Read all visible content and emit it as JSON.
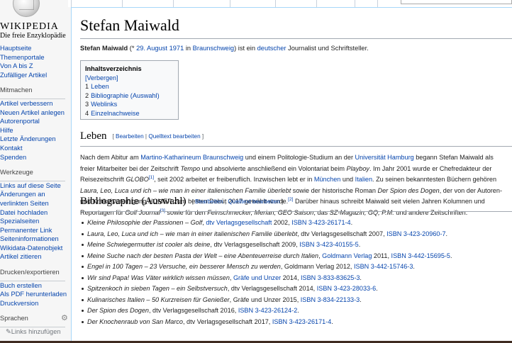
{
  "logo": {
    "wordmark": "WIKIPEDIA",
    "tagline": "Die freie Enzyklopädie"
  },
  "sidebar": {
    "nav": [
      "Hauptseite",
      "Themenportale",
      "Von A bis Z",
      "Zufälliger Artikel"
    ],
    "mitmachen": {
      "heading": "Mitmachen",
      "items": [
        "Artikel verbessern",
        "Neuen Artikel anlegen",
        "Autorenportal",
        "Hilfe",
        "Letzte Änderungen",
        "Kontakt",
        "Spenden"
      ]
    },
    "werkzeuge": {
      "heading": "Werkzeuge",
      "items": [
        "Links auf diese Seite",
        "Änderungen an",
        "verlinkten Seiten",
        "Datei hochladen",
        "Spezialseiten",
        "Permanenter Link",
        "Seiteninformationen",
        "Wikidata-Datenobjekt",
        "Artikel zitieren"
      ]
    },
    "drucken": {
      "heading": "Drucken/exportieren",
      "items": [
        "Buch erstellen",
        "Als PDF herunterladen",
        "Druckversion"
      ]
    },
    "sprachen": {
      "heading": "Sprachen",
      "add_links": "Links hinzufügen"
    }
  },
  "page": {
    "title": "Stefan Maiwald",
    "lead": {
      "name": "Stefan Maiwald",
      "pre": " (* ",
      "date": "29. August 1971",
      "in": " in ",
      "city": "Braunschweig",
      "mid": ") ist ein ",
      "nationality": "deutscher",
      "rest": " Journalist und Schriftsteller."
    },
    "toc": {
      "title": "Inhaltsverzeichnis",
      "toggle": "[Verbergen]",
      "entries": [
        {
          "num": "1",
          "label": "Leben"
        },
        {
          "num": "2",
          "label": "Bibliographie (Auswahl)"
        },
        {
          "num": "3",
          "label": "Weblinks"
        },
        {
          "num": "4",
          "label": "Einzelnachweise"
        }
      ]
    },
    "edit": {
      "open": "[ ",
      "edit": "Bearbeiten",
      "sep": " | ",
      "source": "Quelltext bearbeiten",
      "close": " ]"
    },
    "leben": {
      "heading": "Leben",
      "l1": {
        "a": "Nach dem Abitur am ",
        "link1": "Martino-Katharineum Braunschweig",
        "b": " und einem Politologie-Studium an der ",
        "link2": "Universität Hamburg",
        "c": " begann Stefan Maiwald als"
      },
      "l2": {
        "a": "freier Mitarbeiter bei der Zeitschrift ",
        "i1": "Tempo",
        "b": " und absolvierte anschließend ein Volontariat beim ",
        "i2": "Playboy",
        "c": ". Im Jahr 2001 wurde er Chefredakteur der"
      },
      "l3": {
        "a": "Reisezeitschrift ",
        "i1": "GLOBO",
        "ref": "[1]",
        "b": ", seit 2002 arbeitet er freiberuflich. Inzwischen lebt er in ",
        "link1": "München",
        "c": " und ",
        "link2": "Italien",
        "d": ". Zu seinen bekanntesten Büchern gehören"
      },
      "l4": {
        "i1": "Laura, Leo, Luca und ich – wie man in einer italienischen Familie überlebt",
        "a": " sowie der historische Roman ",
        "i2": "Der Spion des Dogen",
        "b": ", der von der Autoren-"
      },
      "l5": {
        "a": "und Kritikervereinigung HOMER zum besten Debüt 2017 gewählt wurde.",
        "ref": "[2]",
        "b": " Darüber hinaus schreibt Maiwald seit vielen Jahren Kolumnen und"
      },
      "l6": {
        "a": "Reportagen für ",
        "i1": "Golf Journal",
        "ref": "[3]",
        "b": " sowie für den ",
        "i2": "Feinschmecker, Merian, GEO Saison",
        "c": ", das ",
        "i3": "SZ-Magazin, GQ, P.M.",
        "d": " und andere Zeitschriften."
      }
    },
    "biblio": {
      "heading": "Bibliographie (Auswahl)",
      "items": [
        {
          "title": "Kleine Philosophie der Passionen – Golf",
          "sep": ", ",
          "publisher": "dtv Verlagsgesellschaft",
          "publisher_link": true,
          "year": " 2002, ",
          "isbn": "ISBN 3-423-26171-4",
          "end": "."
        },
        {
          "title": "Laura, Leo, Luca und ich – wie man in einer italienischen Familie überlebt",
          "sep": ", ",
          "publisher": "dtv Verlagsgesellschaft",
          "publisher_link": false,
          "year": " 2007, ",
          "isbn": "ISBN 3-423-20960-7",
          "end": "."
        },
        {
          "title": "Meine Schwiegermutter ist cooler als deine",
          "sep": ", ",
          "publisher": "dtv Verlagsgesellschaft",
          "publisher_link": false,
          "year": " 2009, ",
          "isbn": "ISBN 3-423-40155-5",
          "end": "."
        },
        {
          "title": "Meine Suche nach der besten Pasta der Welt – eine Abenteuerreise durch Italien",
          "sep": ", ",
          "publisher": "Goldmann Verlag",
          "publisher_link": true,
          "year": " 2011, ",
          "isbn": "ISBN 3-442-15695-5",
          "end": "."
        },
        {
          "title": "Engel in 100 Tagen – 23 Versuche, ein besserer Mensch zu werden",
          "sep": ", ",
          "publisher": "Goldmann Verlag",
          "publisher_link": false,
          "year": " 2012, ",
          "isbn": "ISBN 3-442-15746-3",
          "end": "."
        },
        {
          "title": "Wir sind Papa! Was Väter wirklich wissen müssen",
          "sep": ", ",
          "publisher": "Gräfe und Unzer",
          "publisher_link": true,
          "year": " 2014, ",
          "isbn": "ISBN 3-833-83625-3",
          "end": "."
        },
        {
          "title": "Spitzenkoch in sieben Tagen – ein Selbstversuch",
          "sep": ", ",
          "publisher": "dtv Verlagsgesellschaft",
          "publisher_link": false,
          "year": " 2014, ",
          "isbn": "ISBN 3-423-28033-6",
          "end": "."
        },
        {
          "title": "Kulinarisches Italien – 50 Kurzreisen für Genießer",
          "sep": ", ",
          "publisher": "Gräfe und Unzer",
          "publisher_link": false,
          "year": " 2015, ",
          "isbn": "ISBN 3-834-22133-3",
          "end": "."
        },
        {
          "title": "Der Spion des Dogen",
          "sep": ", ",
          "publisher": "dtv Verlagsgesellschaft",
          "publisher_link": false,
          "year": " 2016, ",
          "isbn": "ISBN 3-423-26124-2",
          "end": "."
        },
        {
          "title": "Der Knochenraub von San Marco",
          "sep": ", ",
          "publisher": "dtv Verlagsgesellschaft",
          "publisher_link": false,
          "year": " 2017, ",
          "isbn": "ISBN 3-423-26171-4",
          "end": "."
        }
      ]
    }
  }
}
